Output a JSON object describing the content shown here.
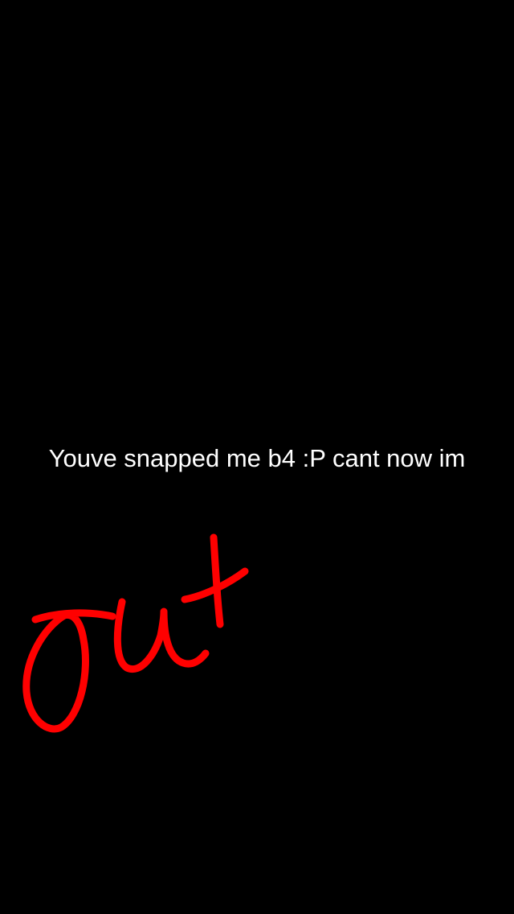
{
  "snap": {
    "caption": "Youve snapped me b4 :P cant now im",
    "background_color": "#000000",
    "caption_color": "#ffffff"
  },
  "doodle": {
    "text": "out",
    "color": "#ff0000"
  }
}
